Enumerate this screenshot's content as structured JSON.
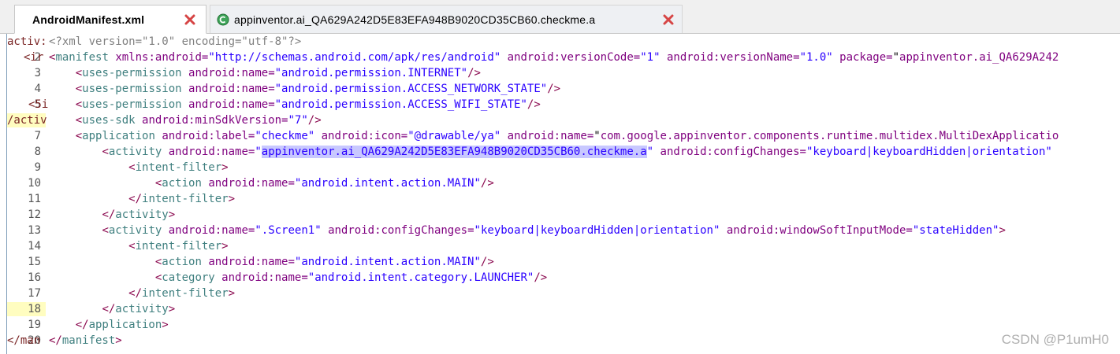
{
  "tabs": [
    {
      "label": "AndroidManifest.xml",
      "active": true
    },
    {
      "label": "appinventor.ai_QA629A242D5E83EFA948B9020CD35CB60.checkme.a",
      "active": false
    }
  ],
  "colors": {
    "bracket": "#8b0a50",
    "tag_name": "#3f7f7f",
    "attribute": "#7f007f",
    "value": "#2a00ff",
    "selection": "#c8c8ff",
    "gutter_highlight": "#fffdc0",
    "close_icon": "#d64545"
  },
  "gutter_fragments": [
    "activ:",
    "<ir",
    "<5i",
    "/activ",
    "</man"
  ],
  "lines": [
    {
      "n": "",
      "code": "<?xml version=\"1.0\" encoding=\"utf-8\"?>"
    },
    {
      "n": "2",
      "code": "<manifest xmlns:android=\"http://schemas.android.com/apk/res/android\" android:versionCode=\"1\" android:versionName=\"1.0\" package=\"appinventor.ai_QA629A242"
    },
    {
      "n": "3",
      "code": "    <uses-permission android:name=\"android.permission.INTERNET\"/>"
    },
    {
      "n": "4",
      "code": "    <uses-permission android:name=\"android.permission.ACCESS_NETWORK_STATE\"/>"
    },
    {
      "n": "5",
      "code": "    <uses-permission android:name=\"android.permission.ACCESS_WIFI_STATE\"/>"
    },
    {
      "n": "",
      "code": "    <uses-sdk android:minSdkVersion=\"7\"/>"
    },
    {
      "n": "7",
      "code": "    <application android:label=\"checkme\" android:icon=\"@drawable/ya\" android:name=\"com.google.appinventor.components.runtime.multidex.MultiDexApplicatio"
    },
    {
      "n": "8",
      "code": "        <activity android:name=\"appinventor.ai_QA629A242D5E83EFA948B9020CD35CB60.checkme.a\" android:configChanges=\"keyboard|keyboardHidden|orientation\""
    },
    {
      "n": "9",
      "code": "            <intent-filter>"
    },
    {
      "n": "10",
      "code": "                <action android:name=\"android.intent.action.MAIN\"/>"
    },
    {
      "n": "11",
      "code": "            </intent-filter>"
    },
    {
      "n": "12",
      "code": "        </activity>"
    },
    {
      "n": "13",
      "code": "        <activity android:name=\".Screen1\" android:configChanges=\"keyboard|keyboardHidden|orientation\" android:windowSoftInputMode=\"stateHidden\">"
    },
    {
      "n": "14",
      "code": "            <intent-filter>"
    },
    {
      "n": "15",
      "code": "                <action android:name=\"android.intent.action.MAIN\"/>"
    },
    {
      "n": "16",
      "code": "                <category android:name=\"android.intent.category.LAUNCHER\"/>"
    },
    {
      "n": "17",
      "code": "            </intent-filter>"
    },
    {
      "n": "18",
      "code": "        </activity>"
    },
    {
      "n": "19",
      "code": "    </application>"
    },
    {
      "n": "20",
      "code": "</manifest>"
    }
  ],
  "selection": "appinventor.ai_QA629A242D5E83EFA948B9020CD35CB60.checkme.a",
  "watermark": "CSDN @P1umH0"
}
